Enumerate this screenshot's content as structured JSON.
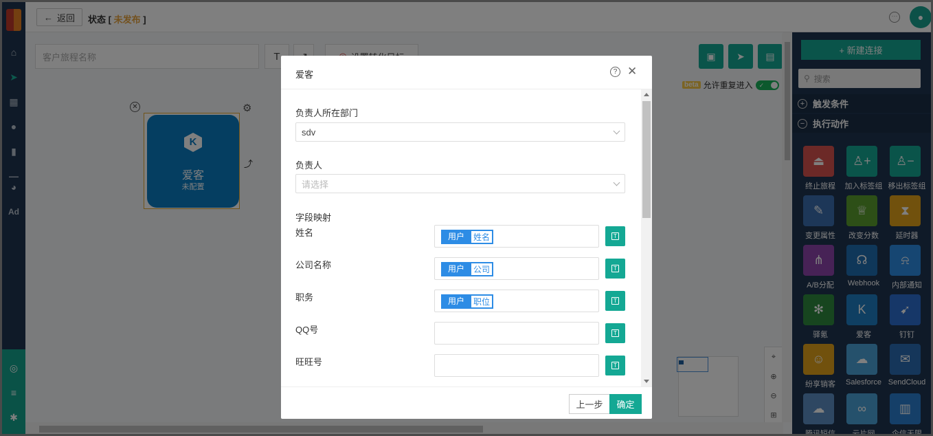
{
  "header": {
    "back_label": "返回",
    "status_prefix": "状态 [",
    "status_value": "未发布",
    "status_suffix": "]"
  },
  "canvas": {
    "journey_name_placeholder": "客户旅程名称",
    "text_tool": "T",
    "goal_label": "设置转化目标",
    "node": {
      "title": "爱客",
      "subtitle": "未配置"
    },
    "repeat": {
      "beta": "beta",
      "label": "允许重复进入",
      "enabled": true
    }
  },
  "right_panel": {
    "new_connection": "+ 新建连接",
    "search_placeholder": "搜索",
    "sections": [
      {
        "label": "触发条件",
        "state": "collapsed"
      },
      {
        "label": "执行动作",
        "state": "expanded"
      }
    ],
    "tiles": [
      {
        "label": "终止旅程",
        "icon": "stop-icon",
        "color": "#d9534f"
      },
      {
        "label": "加入标签组",
        "icon": "user-plus-icon",
        "color": "#14a894"
      },
      {
        "label": "移出标签组",
        "icon": "user-minus-icon",
        "color": "#14a894"
      },
      {
        "label": "变更属性",
        "icon": "edit-icon",
        "color": "#3a6fb0"
      },
      {
        "label": "改变分数",
        "icon": "trophy-icon",
        "color": "#5a9e2f"
      },
      {
        "label": "延时器",
        "icon": "hourglass-icon",
        "color": "#e3a21a"
      },
      {
        "label": "A/B分配",
        "icon": "split-icon",
        "color": "#8e44ad"
      },
      {
        "label": "Webhook",
        "icon": "webhook-icon",
        "color": "#1f6fb2"
      },
      {
        "label": "内部通知",
        "icon": "bell-icon",
        "color": "#2d8ce5"
      },
      {
        "label": "驿氪",
        "icon": "spider-icon",
        "color": "#2e8b3e"
      },
      {
        "label": "爱客",
        "icon": "k-icon",
        "color": "#1f7fc4"
      },
      {
        "label": "钉钉",
        "icon": "dingtalk-icon",
        "color": "#2d6fd0"
      },
      {
        "label": "纷享销客",
        "icon": "robot-icon",
        "color": "#e3a21a"
      },
      {
        "label": "Salesforce",
        "icon": "cloud-icon",
        "color": "#4aa3d8"
      },
      {
        "label": "SendCloud",
        "icon": "mail-icon",
        "color": "#2a6db5"
      },
      {
        "label": "腾讯短信",
        "icon": "cloud-outline-icon",
        "color": "#5c8fc4"
      },
      {
        "label": "云片网",
        "icon": "link-icon",
        "color": "#4aa3d8"
      },
      {
        "label": "企信无限",
        "icon": "chart-icon",
        "color": "#2a7fd0"
      }
    ]
  },
  "modal": {
    "title": "爱客",
    "dept_label": "负责人所在部门",
    "dept_value": "sdv",
    "owner_label": "负责人",
    "owner_placeholder": "请选择",
    "mapping_label": "字段映射",
    "mapping_rows": [
      {
        "label": "姓名",
        "chip_source": "用户",
        "chip_field": "姓名"
      },
      {
        "label": "公司名称",
        "chip_source": "用户",
        "chip_field": "公司"
      },
      {
        "label": "职务",
        "chip_source": "用户",
        "chip_field": "职位"
      },
      {
        "label": "QQ号",
        "chip_source": "",
        "chip_field": ""
      },
      {
        "label": "旺旺号",
        "chip_source": "",
        "chip_field": ""
      }
    ],
    "prev_button": "上一步",
    "ok_button": "确定"
  }
}
